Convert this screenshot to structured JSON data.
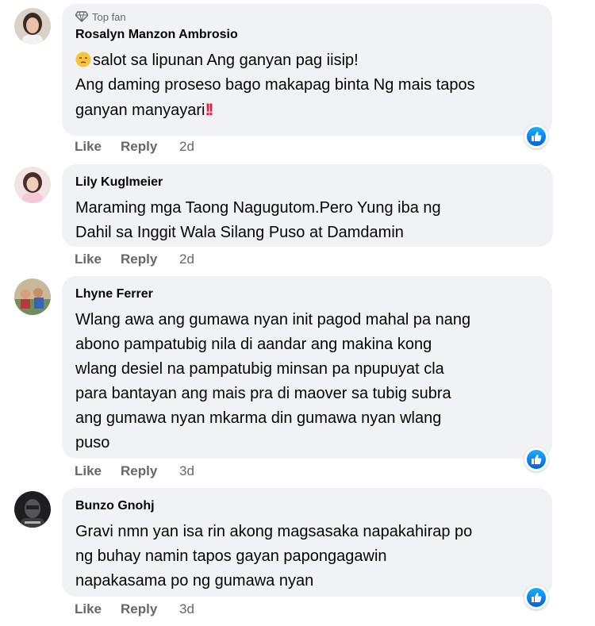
{
  "comments": [
    {
      "badge": "Top fan",
      "author": "Rosalyn Manzon Ambrosio",
      "lines": [
        "salot sa lipunan Ang ganyan pag iisip!",
        "Ang daming proseso bago makapag binta Ng mais tapos",
        "ganyan manyayari"
      ],
      "like": "Like",
      "reply": "Reply",
      "time": "2d",
      "reaction": "like-reaction-icon"
    },
    {
      "author": "Lily Kuglmeier",
      "lines": [
        "Maraming mga Taong Nagugutom.Pero Yung iba ng",
        "Dahil sa Inggit Wala Silang Puso at Damdamin"
      ],
      "like": "Like",
      "reply": "Reply",
      "time": "2d"
    },
    {
      "author": "Lhyne Ferrer",
      "lines": [
        "Wlang awa ang gumawa nyan init pagod mahal pa nang",
        "abono pampatubig nila di aandar ang makina kong",
        "wlang desiel na pampatubig minsan pa npupuyat cla",
        "para bantayan ang mais pra di maover sa tubig subra",
        "ang gumawa nyan mkarma din gumawa nyan wlang",
        "puso"
      ],
      "like": "Like",
      "reply": "Reply",
      "time": "3d",
      "reaction": "like-reaction-icon"
    },
    {
      "author": "Bunzo Gnohj",
      "lines": [
        "Gravi nmn yan isa rin akong magsasaka napakahirap po",
        "ng buhay namin tapos gayan papongagawin",
        "napakasama po ng gumawa nyan"
      ],
      "like": "Like",
      "reply": "Reply",
      "time": "3d",
      "reaction": "like-reaction-icon"
    }
  ],
  "colors": {
    "bubble": "#f0f2f5",
    "meta": "#65676b",
    "like_blue": "#0866ff",
    "emoji_red": "#e41e3f"
  }
}
